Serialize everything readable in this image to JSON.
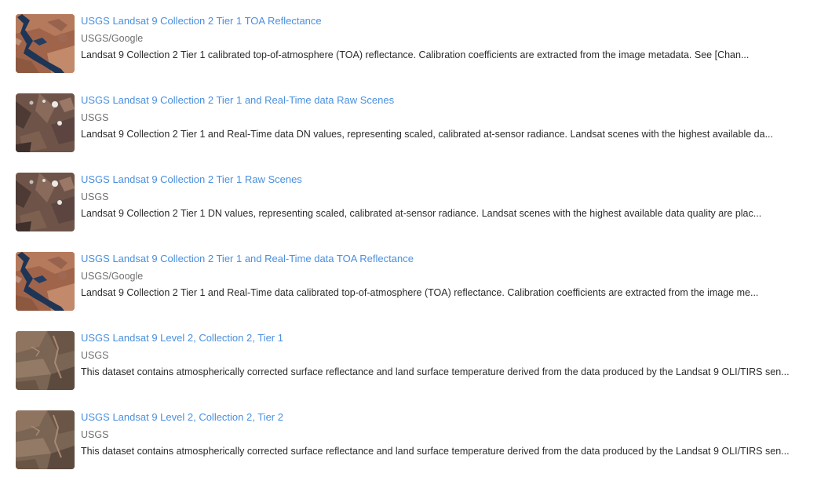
{
  "results": [
    {
      "title": "USGS Landsat 9 Collection 2 Tier 1 TOA Reflectance",
      "provider": "USGS/Google",
      "description": "Landsat 9 Collection 2 Tier 1 calibrated top-of-atmosphere (TOA) reflectance. Calibration coefficients are extracted from the image metadata. See [Chan...",
      "thumbnail": "lake-canyon"
    },
    {
      "title": "USGS Landsat 9 Collection 2 Tier 1 and Real-Time data Raw Scenes",
      "provider": "USGS",
      "description": "Landsat 9 Collection 2 Tier 1 and Real-Time data DN values, representing scaled, calibrated at-sensor radiance. Landsat scenes with the highest available da...",
      "thumbnail": "mountains-snow"
    },
    {
      "title": "USGS Landsat 9 Collection 2 Tier 1 Raw Scenes",
      "provider": "USGS",
      "description": "Landsat 9 Collection 2 Tier 1 DN values, representing scaled, calibrated at-sensor radiance. Landsat scenes with the highest available data quality are plac...",
      "thumbnail": "mountains-snow"
    },
    {
      "title": "USGS Landsat 9 Collection 2 Tier 1 and Real-Time data TOA Reflectance",
      "provider": "USGS/Google",
      "description": "Landsat 9 Collection 2 Tier 1 and Real-Time data calibrated top-of-atmosphere (TOA) reflectance. Calibration coefficients are extracted from the image me...",
      "thumbnail": "lake-canyon"
    },
    {
      "title": "USGS Landsat 9 Level 2, Collection 2, Tier 1",
      "provider": "USGS",
      "description": "This dataset contains atmospherically corrected surface reflectance and land surface temperature derived from the data produced by the Landsat 9 OLI/TIRS sen...",
      "thumbnail": "desert-plateau"
    },
    {
      "title": "USGS Landsat 9 Level 2, Collection 2, Tier 2",
      "provider": "USGS",
      "description": "This dataset contains atmospherically corrected surface reflectance and land surface temperature derived from the data produced by the Landsat 9 OLI/TIRS sen...",
      "thumbnail": "desert-plateau"
    }
  ],
  "colors": {
    "link": "#4a8fde",
    "provider": "#6f6f6f",
    "description": "#2b2b2b"
  }
}
